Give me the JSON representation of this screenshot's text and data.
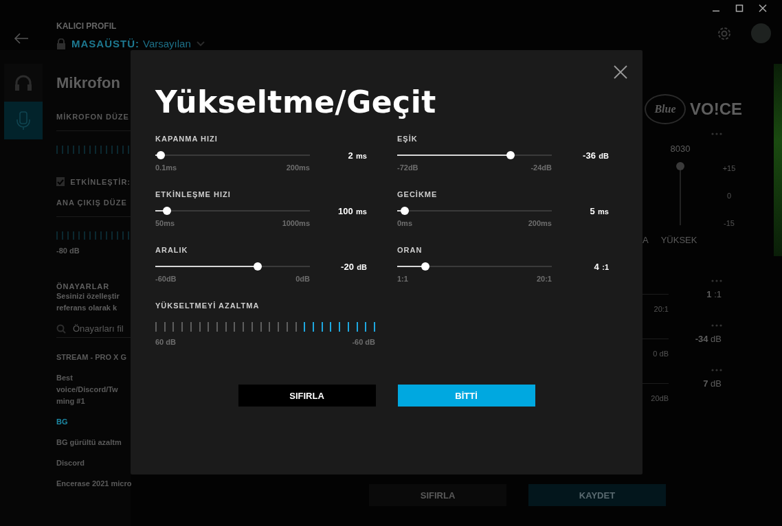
{
  "header": {
    "label": "KALICI PROFIL",
    "profile": {
      "prefix": "MASAÜSTÜ:",
      "name": "Varsayılan"
    }
  },
  "sidebar": {
    "items": [
      {
        "kind": "headphones",
        "selected": false
      },
      {
        "kind": "microphone",
        "selected": true
      }
    ]
  },
  "panel": {
    "title": "Mikrofon",
    "mic_level_label": "MİKROFON DÜZE",
    "enable": {
      "label": "ETKİNLEŞTİR:",
      "checked": true
    },
    "output_level_label": "ANA ÇIKIŞ DÜZE",
    "output_min": "-80 dB",
    "presets": {
      "title": "ÖNAYARLAR",
      "description": [
        "Sesinizi özelleştir",
        "referans olarak k"
      ],
      "search": {
        "placeholder": "Önayarları fil"
      },
      "items": [
        {
          "lines": [
            "STREAM - PRO X G"
          ],
          "selected": false
        },
        {
          "lines": [
            "Best",
            "voice/Discord/Tw",
            "ming #1"
          ],
          "selected": false
        },
        {
          "lines": [
            "BG"
          ],
          "selected": true
        },
        {
          "lines": [
            "BG gürültü azaltm"
          ],
          "selected": false
        },
        {
          "lines": [
            "Discord"
          ],
          "selected": false
        },
        {
          "lines": [
            "Encerase 2021 micro"
          ],
          "selected": false
        }
      ]
    }
  },
  "modal": {
    "title": "Yükseltme/Geçit",
    "sliders": [
      {
        "label": "KAPANMA HIZI",
        "level": 0.035,
        "value": "2",
        "unit": "ms",
        "min": "0.1ms",
        "max": "200ms"
      },
      {
        "label": "EŞİK",
        "level": 0.735,
        "value": "-36",
        "unit": "dB",
        "min": "-72dB",
        "max": "-24dB"
      },
      {
        "label": "ETKİNLEŞME HIZI",
        "level": 0.075,
        "value": "100",
        "unit": "ms",
        "min": "50ms",
        "max": "1000ms"
      },
      {
        "label": "GECİKME",
        "level": 0.05,
        "value": "5",
        "unit": "ms",
        "min": "0ms",
        "max": "200ms"
      },
      {
        "label": "ARALIK",
        "level": 0.66,
        "value": "-20",
        "unit": "dB",
        "min": "-60dB",
        "max": "0dB"
      },
      {
        "label": "ORAN",
        "level": 0.18,
        "value": "4",
        "unit": ":1",
        "min": "1:1",
        "max": "20:1"
      }
    ],
    "gain_reduction": {
      "label": "YÜKSELTMEYİ AZALTMA",
      "level": 0.35,
      "min": "60 dB",
      "max": "-60 dB"
    },
    "buttons": [
      {
        "label": "SIFIRLA",
        "kind": "secondary"
      },
      {
        "label": "BİTTİ",
        "kind": "primary"
      }
    ]
  },
  "right_panel": {
    "logo": {
      "badge": "Blue",
      "text": "VO!CE"
    },
    "eq": {
      "freq_label": "8030",
      "level": 0.98,
      "scale": [
        "+15",
        "0",
        "-15"
      ],
      "band_labels": [
        "A",
        "YÜKSEK"
      ]
    },
    "controls": [
      {
        "value": "1",
        "unit": ":1",
        "max": "20:1"
      },
      {
        "value": "-34",
        "unit": "dB",
        "max": "0 dB"
      },
      {
        "value": "7",
        "unit": "dB",
        "max": "20dB"
      }
    ]
  },
  "bottom_buttons": [
    {
      "label": "SIFIRLA",
      "kind": "secondary"
    },
    {
      "label": "KAYDET",
      "kind": "primary"
    }
  ]
}
